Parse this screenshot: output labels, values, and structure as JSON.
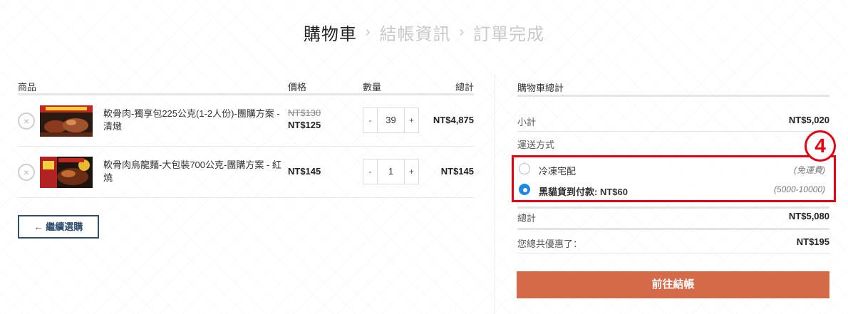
{
  "steps": [
    {
      "label": "購物車",
      "active": true
    },
    {
      "label": "結帳資訊",
      "active": false
    },
    {
      "label": "訂單完成",
      "active": false
    }
  ],
  "step_separator": "›",
  "cart": {
    "headers": {
      "product": "商品",
      "price": "價格",
      "quantity": "數量",
      "total": "總計"
    },
    "items": [
      {
        "name": "軟骨肉-獨享包225公克(1-2人份)-團購方案 - 清燉",
        "old_price": "NT$130",
        "price": "NT$125",
        "quantity": "39",
        "total": "NT$4,875"
      },
      {
        "name": "軟骨肉烏龍麵-大包裝700公克-團購方案 - 紅燒",
        "old_price": "",
        "price": "NT$145",
        "quantity": "1",
        "total": "NT$145"
      }
    ],
    "qty_minus": "-",
    "qty_plus": "+",
    "remove_symbol": "×",
    "continue_label": "← 繼續選購"
  },
  "totals": {
    "title": "購物車總計",
    "subtotal_label": "小計",
    "subtotal_value": "NT$5,020",
    "shipping_label": "運送方式",
    "shipping_options": [
      {
        "label": "冷凍宅配",
        "note": "(免運費)",
        "selected": false
      },
      {
        "label": "黑貓貨到付款: NT$60",
        "note": "(5000-10000)",
        "selected": true
      }
    ],
    "total_label": "總計",
    "total_value": "NT$5,080",
    "discount_label": "您總共優惠了：",
    "discount_value": "NT$195",
    "checkout_label": "前往結帳"
  },
  "annotation_badge": "4",
  "colors": {
    "accent": "#d46a48",
    "annotation": "#e60012",
    "radio_selected": "#1e88e5",
    "continue_border": "#2f4f6f"
  }
}
